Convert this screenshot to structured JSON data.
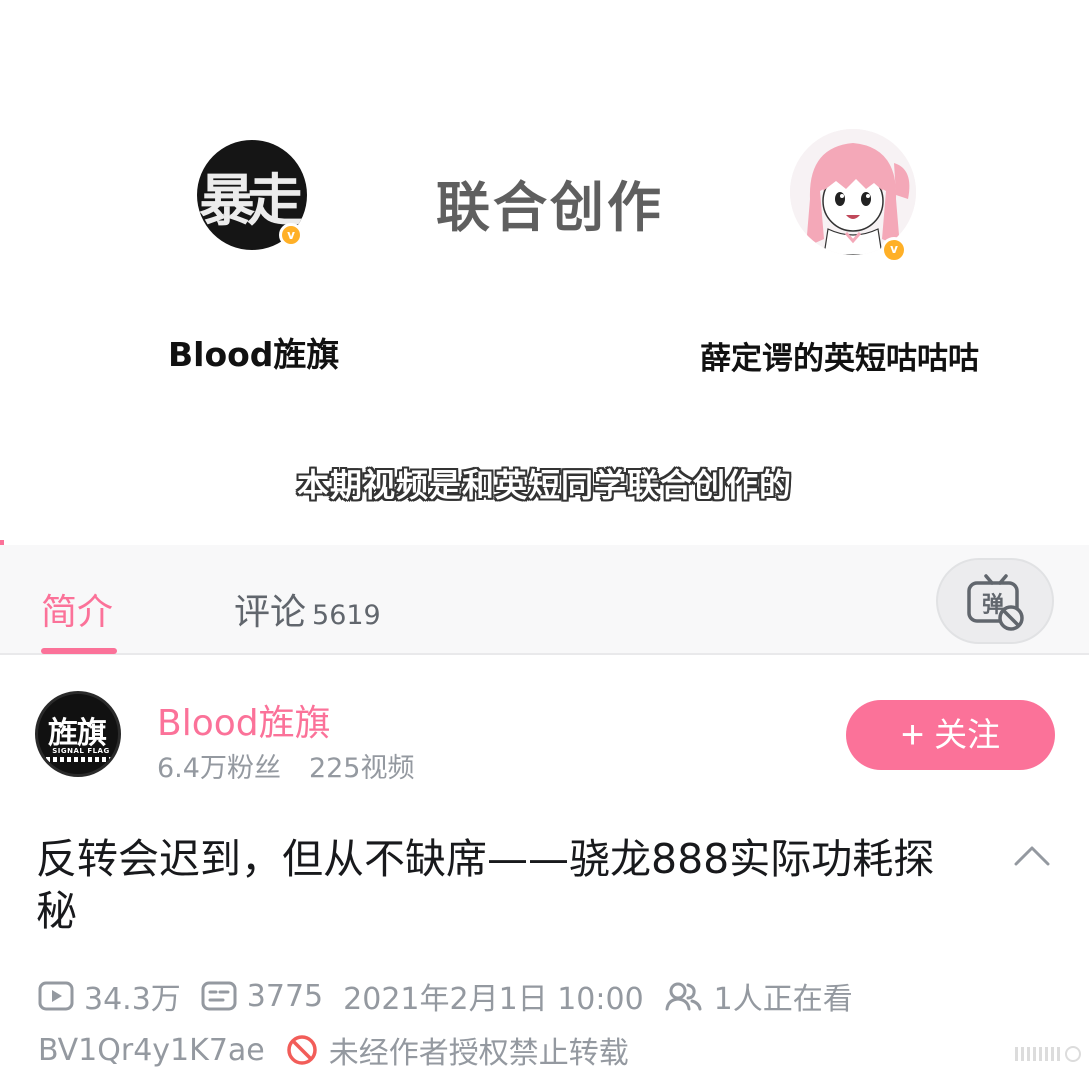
{
  "video_frame": {
    "collab_title": "联合创作",
    "left_creator": {
      "avatar_text": "暴走",
      "name": "Blood旌旗"
    },
    "right_creator": {
      "name": "薛定谔的英短咕咕咕"
    },
    "verified_badge": "v",
    "subtitle": "本期视频是和英短同学联合创作的"
  },
  "tabs": {
    "intro_label": "简介",
    "comments_label": "评论",
    "comments_count": "5619"
  },
  "danmaku_button": {
    "icon": "danmaku-off-icon",
    "glyph": "弹"
  },
  "uploader": {
    "avatar_text": "旌旗",
    "avatar_subtext": "SIGNAL FLAG",
    "name": "Blood旌旗",
    "followers": "6.4万粉丝",
    "videos": "225视频",
    "follow_plus": "+",
    "follow_label": "关注"
  },
  "video": {
    "title": "反转会迟到，但从不缺席——骁龙888实际功耗探秘",
    "views": "34.3万",
    "danmaku_count": "3775",
    "publish_time": "2021年2月1日 10:00",
    "watching_now": "1人正在看",
    "bvid": "BV1Qr4y1K7ae",
    "copyright_notice": "未经作者授权禁止转载"
  },
  "colors": {
    "accent": "#fb7299",
    "text_primary": "#18191c",
    "text_secondary": "#9499a0",
    "tab_bg": "#f8f8f9",
    "badge": "#ffb027",
    "prohibit": "#f25d59"
  }
}
